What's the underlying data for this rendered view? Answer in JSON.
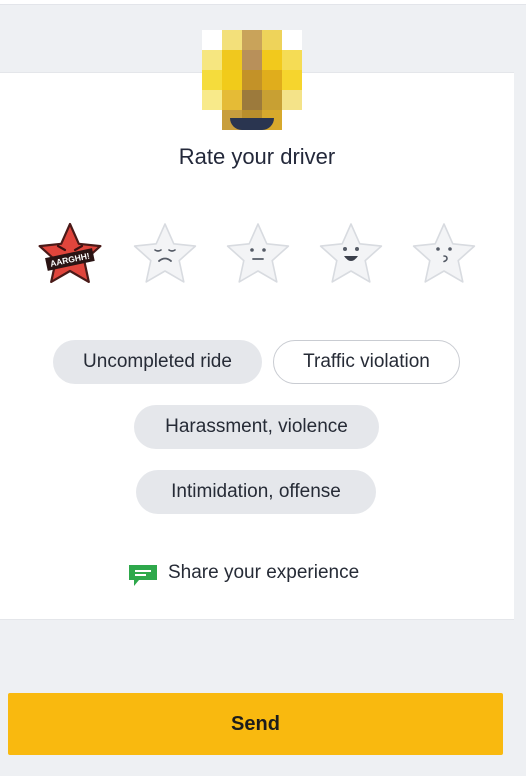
{
  "rating": {
    "title": "Rate your driver",
    "selected_stars": 1,
    "max_stars": 5,
    "stars": [
      {
        "mood": "angry",
        "badge": "AARGHH!",
        "color": "#e0453c"
      },
      {
        "mood": "sad",
        "color": "#f2f3f5"
      },
      {
        "mood": "neutral",
        "color": "#f2f3f5"
      },
      {
        "mood": "happy",
        "color": "#f2f3f5"
      },
      {
        "mood": "puzzled",
        "color": "#f2f3f5"
      }
    ]
  },
  "issues": {
    "tags": [
      {
        "label": "Uncompleted ride",
        "selected": true
      },
      {
        "label": "Traffic violation",
        "selected": false
      },
      {
        "label": "Harassment, violence",
        "selected": true
      },
      {
        "label": "Intimidation, offense",
        "selected": true
      }
    ]
  },
  "share": {
    "label": "Share your experience",
    "icon": "chat-bubble-icon",
    "icon_color": "#2ea84b"
  },
  "send": {
    "label": "Send",
    "color": "#f9b90f"
  }
}
